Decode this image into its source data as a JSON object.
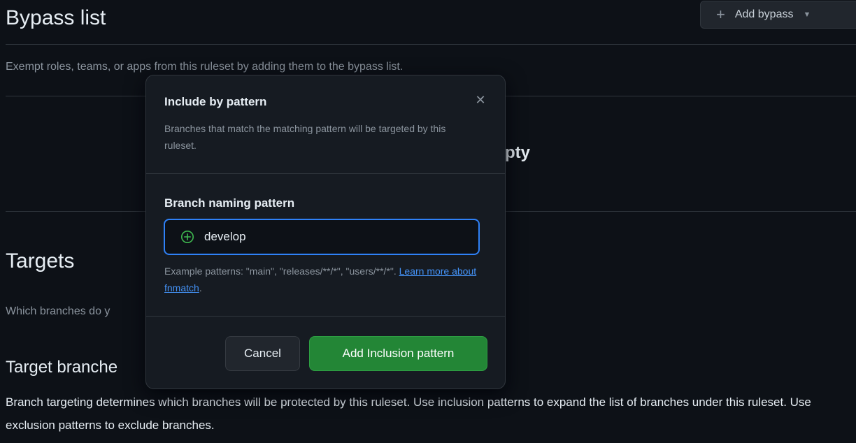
{
  "background": {
    "bypass_title": "Bypass list",
    "add_bypass_label": "Add bypass",
    "bypass_description": "Exempt roles, teams, or apps from this ruleset by adding them to the bypass list.",
    "empty_text_fragment": "pty",
    "targets_title": "Targets",
    "targets_question_fragment": "Which branches do y",
    "target_branches_title_fragment": "Target branche",
    "target_branches_description": "Branch targeting determines which branches will be protected by this ruleset. Use inclusion patterns to expand the list of branches under this ruleset. Use exclusion patterns to exclude branches."
  },
  "dialog": {
    "title": "Include by pattern",
    "subtitle": "Branches that match the matching pattern will be targeted by this ruleset.",
    "field_label": "Branch naming pattern",
    "field_value": "develop",
    "hint_prefix": "Example patterns: \"main\", \"releases/**/*\", \"users/**/*\".",
    "hint_link": "Learn more about fnmatch",
    "hint_suffix": ".",
    "cancel_label": "Cancel",
    "confirm_label": "Add Inclusion pattern"
  },
  "icons": {
    "close": "close-icon",
    "plus": "plus-icon",
    "caret": "caret-down-icon",
    "field": "plus-circle-icon"
  },
  "colors": {
    "background": "#0d1117",
    "dialog": "#161b22",
    "border": "#30363d",
    "accent_blue": "#2f81f7",
    "primary_green": "#238636",
    "success_icon": "#3fb950",
    "link": "#4493f8"
  }
}
